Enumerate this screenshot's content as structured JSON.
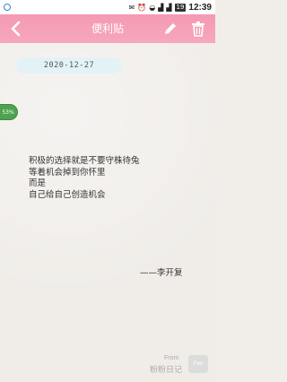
{
  "status_bar": {
    "time": "12:39",
    "battery": "19",
    "app_icon": "sync-icon"
  },
  "header": {
    "title": "便利贴",
    "back_icon": "back-chevron-icon",
    "edit_icon": "pencil-icon",
    "delete_icon": "trash-icon",
    "background_color": "#f49ab2"
  },
  "note": {
    "date": "2020-12-27",
    "badge": "53%",
    "lines": [
      "积极的选择就是不要守株待兔",
      "等着机会掉到你怀里",
      "而是",
      "自己给自己创造机会"
    ],
    "signature": "——李开复"
  },
  "footer": {
    "from_label": "From",
    "brand_name": "粉粉日记",
    "brand_logo_text": "Fen"
  }
}
